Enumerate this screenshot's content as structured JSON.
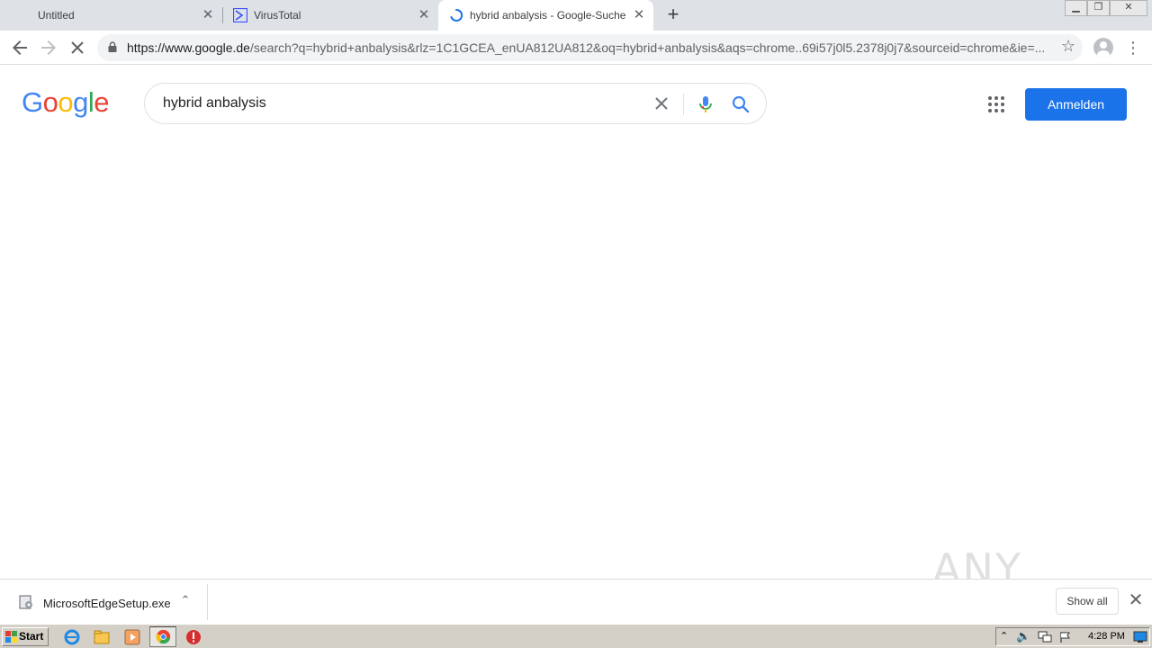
{
  "browser": {
    "tabs": [
      {
        "title": "Untitled",
        "active": false
      },
      {
        "title": "VirusTotal",
        "active": false
      },
      {
        "title": "hybrid anbalysis - Google-Suche",
        "active": true
      }
    ],
    "new_tab_label": "+",
    "url_prefix": "https://www.google.de",
    "url_rest": "/search?q=hybrid+anbalysis&rlz=1C1GCEA_enUA812UA812&oq=hybrid+anbalysis&aqs=chrome..69i57j0l5.2378j0j7&sourceid=chrome&ie=..."
  },
  "page": {
    "logo_letters": [
      "G",
      "o",
      "o",
      "g",
      "l",
      "e"
    ],
    "logo_colors": [
      "#4285f4",
      "#ea4335",
      "#fbbc05",
      "#4285f4",
      "#34a853",
      "#ea4335"
    ],
    "search_value": "hybrid anbalysis",
    "signin_label": "Anmelden",
    "accent": "#1a73e8"
  },
  "downloads": {
    "file_name": "MicrosoftEdgeSetup.exe",
    "show_all_label": "Show all"
  },
  "watermark": "ANY RUN",
  "taskbar": {
    "start_label": "Start",
    "clock": "4:28 PM"
  }
}
